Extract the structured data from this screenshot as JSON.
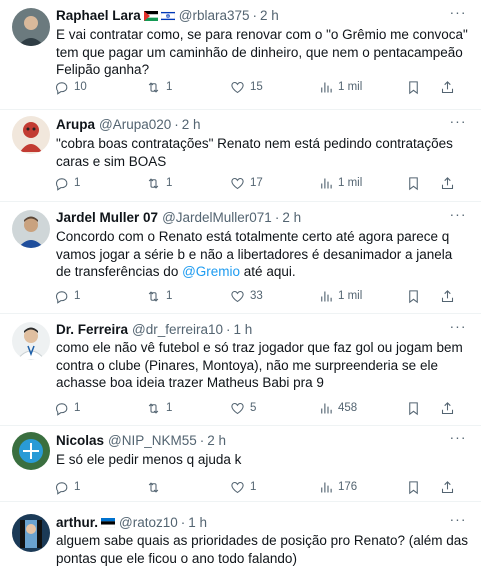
{
  "tweets": [
    {
      "name": "Raphael Lara",
      "flags": [
        "palestine-flag-icon",
        "israel-flag-icon"
      ],
      "handle": "@rblara375",
      "time": "2 h",
      "text": "E vai contratar como, se para renovar com o \"o Grêmio me convoca\" tem que pagar um caminhão de dinheiro, que nem o pentacampeão Felipão ganha?",
      "replies": "10",
      "retweets": "1",
      "likes": "15",
      "views": "1 mil"
    },
    {
      "name": "Arupa",
      "handle": "@Arupa020",
      "time": "2 h",
      "text": "\"cobra boas contratações\" Renato nem está pedindo contratações caras e sim BOAS",
      "replies": "1",
      "retweets": "1",
      "likes": "17",
      "views": "1 mil"
    },
    {
      "name": "Jardel Muller 07",
      "handle": "@JardelMuller071",
      "time": "2 h",
      "text_before": "Concordo com o Renato está totalmente certo até agora parece q vamos jogar a série b e não a libertadores é desanimador a janela de transferências do ",
      "mention": "@Gremio",
      "text_after": " até aqui.",
      "replies": "1",
      "retweets": "1",
      "likes": "33",
      "views": "1 mil"
    },
    {
      "name": "Dr. Ferreira",
      "handle": "@dr_ferreira10",
      "time": "1 h",
      "text": "como ele não vê futebol e só traz jogador que faz gol ou jogam bem contra o clube (Pinares, Montoya), não me surpreenderia se ele achasse boa ideia trazer Matheus Babi pra 9",
      "replies": "1",
      "retweets": "1",
      "likes": "5",
      "views": "458"
    },
    {
      "name": "Nicolas",
      "handle": "@NIP_NKM55",
      "time": "2 h",
      "text": "E só ele pedir menos q ajuda k",
      "replies": "1",
      "retweets": "",
      "likes": "1",
      "views": "176"
    },
    {
      "name": "arthur.",
      "flags": [
        "estonia-flag-icon"
      ],
      "handle": "@ratoz10",
      "time": "1 h",
      "text": "alguem sabe quais as prioridades de posição pro Renato? (além das pontas que ele ficou o ano todo falando)"
    }
  ],
  "separator": "·",
  "more_glyph": "···",
  "colors": {
    "text": "#0f1419",
    "muted": "#536471",
    "link": "#1d9bf0",
    "divider": "#eff3f4"
  }
}
